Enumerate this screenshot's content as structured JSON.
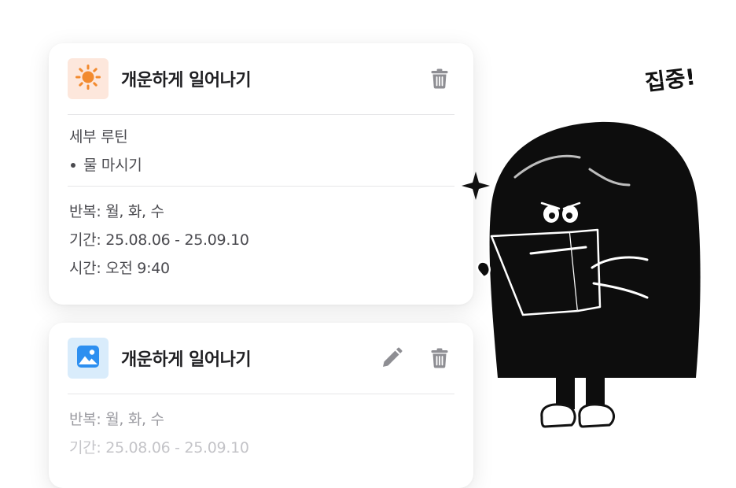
{
  "cards": [
    {
      "icon": "sun-icon",
      "title": "개운하게 일어나기",
      "sub_routine_heading": "세부 루틴",
      "sub_routine_items": [
        "물 마시기"
      ],
      "repeat": "반복: 월, 화, 수",
      "period": "기간: 25.08.06 - 25.09.10",
      "time": "시간: 오전 9:40"
    },
    {
      "icon": "image-icon",
      "title": "개운하게 일어나기",
      "repeat": "반복: 월, 화, 수",
      "period": "기간: 25.08.06 - 25.09.10"
    }
  ],
  "illustration": {
    "caption": "집중!"
  },
  "colors": {
    "sun": "#f28a2e",
    "sun_bg": "#fde7dc",
    "image_icon": "#2d8ff0",
    "image_bg": "#d9ecfb",
    "action_icon": "#8e8e93"
  }
}
